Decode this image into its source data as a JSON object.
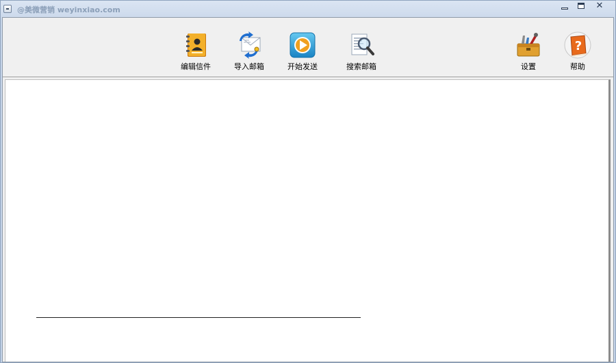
{
  "window": {
    "title": "@美微营销 weyinxiao.com",
    "close_glyph": "✕"
  },
  "toolbar": {
    "items": [
      {
        "label": "编辑信件",
        "icon": "address-book-icon"
      },
      {
        "label": "导入邮箱",
        "icon": "import-mail-icon"
      },
      {
        "label": "开始发送",
        "icon": "play-icon"
      },
      {
        "label": "搜索邮箱",
        "icon": "search-document-icon"
      },
      {
        "label": "设置",
        "icon": "toolbox-icon"
      },
      {
        "label": "帮助",
        "icon": "help-book-icon"
      }
    ]
  },
  "colors": {
    "titlebar": "#c9d7ea",
    "toolbar": "#f0f0f0",
    "content": "#ffffff",
    "play_accent": "#2fa2d8",
    "book_accent": "#f0a020",
    "help_accent": "#e86a1c"
  }
}
